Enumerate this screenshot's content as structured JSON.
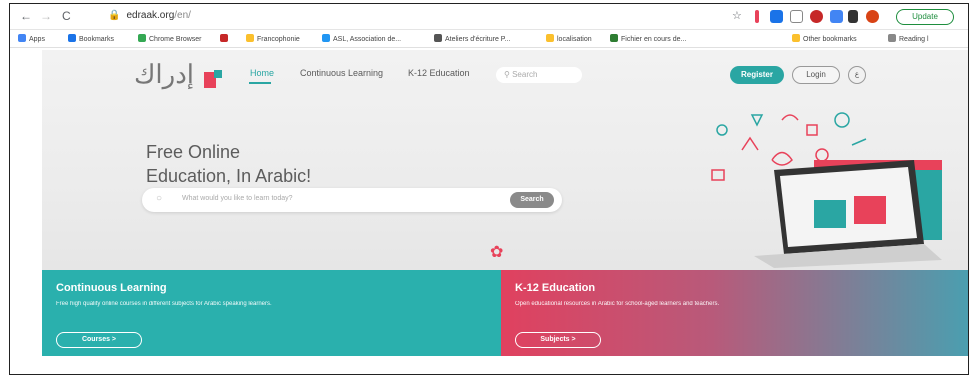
{
  "browser": {
    "url_host": "edraak.org",
    "url_path": "/en/",
    "update_label": "Update",
    "bookmarks": [
      {
        "label": "Apps",
        "color": "#4285f4"
      },
      {
        "label": "Bookmarks",
        "color": "#1a73e8"
      },
      {
        "label": "Chrome Browser",
        "color": "#34a853"
      },
      {
        "label": "",
        "color": "#c62828"
      },
      {
        "label": "Francophonie",
        "color": "#fbc02d"
      },
      {
        "label": "ASL, Association de...",
        "color": "#2196f3"
      },
      {
        "label": "Ateliers d'écriture P...",
        "color": "#555555"
      },
      {
        "label": "localisation",
        "color": "#fbc02d"
      },
      {
        "label": "Fichier en cours de...",
        "color": "#2e7d32"
      }
    ],
    "other_bookmarks": "Other bookmarks",
    "reading_list": "Reading l"
  },
  "site": {
    "logo_text": "إدراك",
    "nav": [
      "Home",
      "Continuous Learning",
      "K-12 Education"
    ],
    "search_placeholder": "Search",
    "register": "Register",
    "login": "Login",
    "lang": "ع",
    "headline_line1": "Free Online",
    "headline_line2": "Education, In Arabic!",
    "hero_search_placeholder": "What would you like to learn today?",
    "hero_search_button": "Search"
  },
  "panels": {
    "left": {
      "title": "Continuous Learning",
      "text": "Free high quality online courses in different subjects for Arabic speaking learners.",
      "button": "Courses  >"
    },
    "right": {
      "title": "K-12 Education",
      "text": "Open educational resources in Arabic for school-aged learners and teachers.",
      "button": "Subjects  >"
    }
  },
  "colors": {
    "teal": "#2aa6a3",
    "pink": "#e0415f"
  }
}
